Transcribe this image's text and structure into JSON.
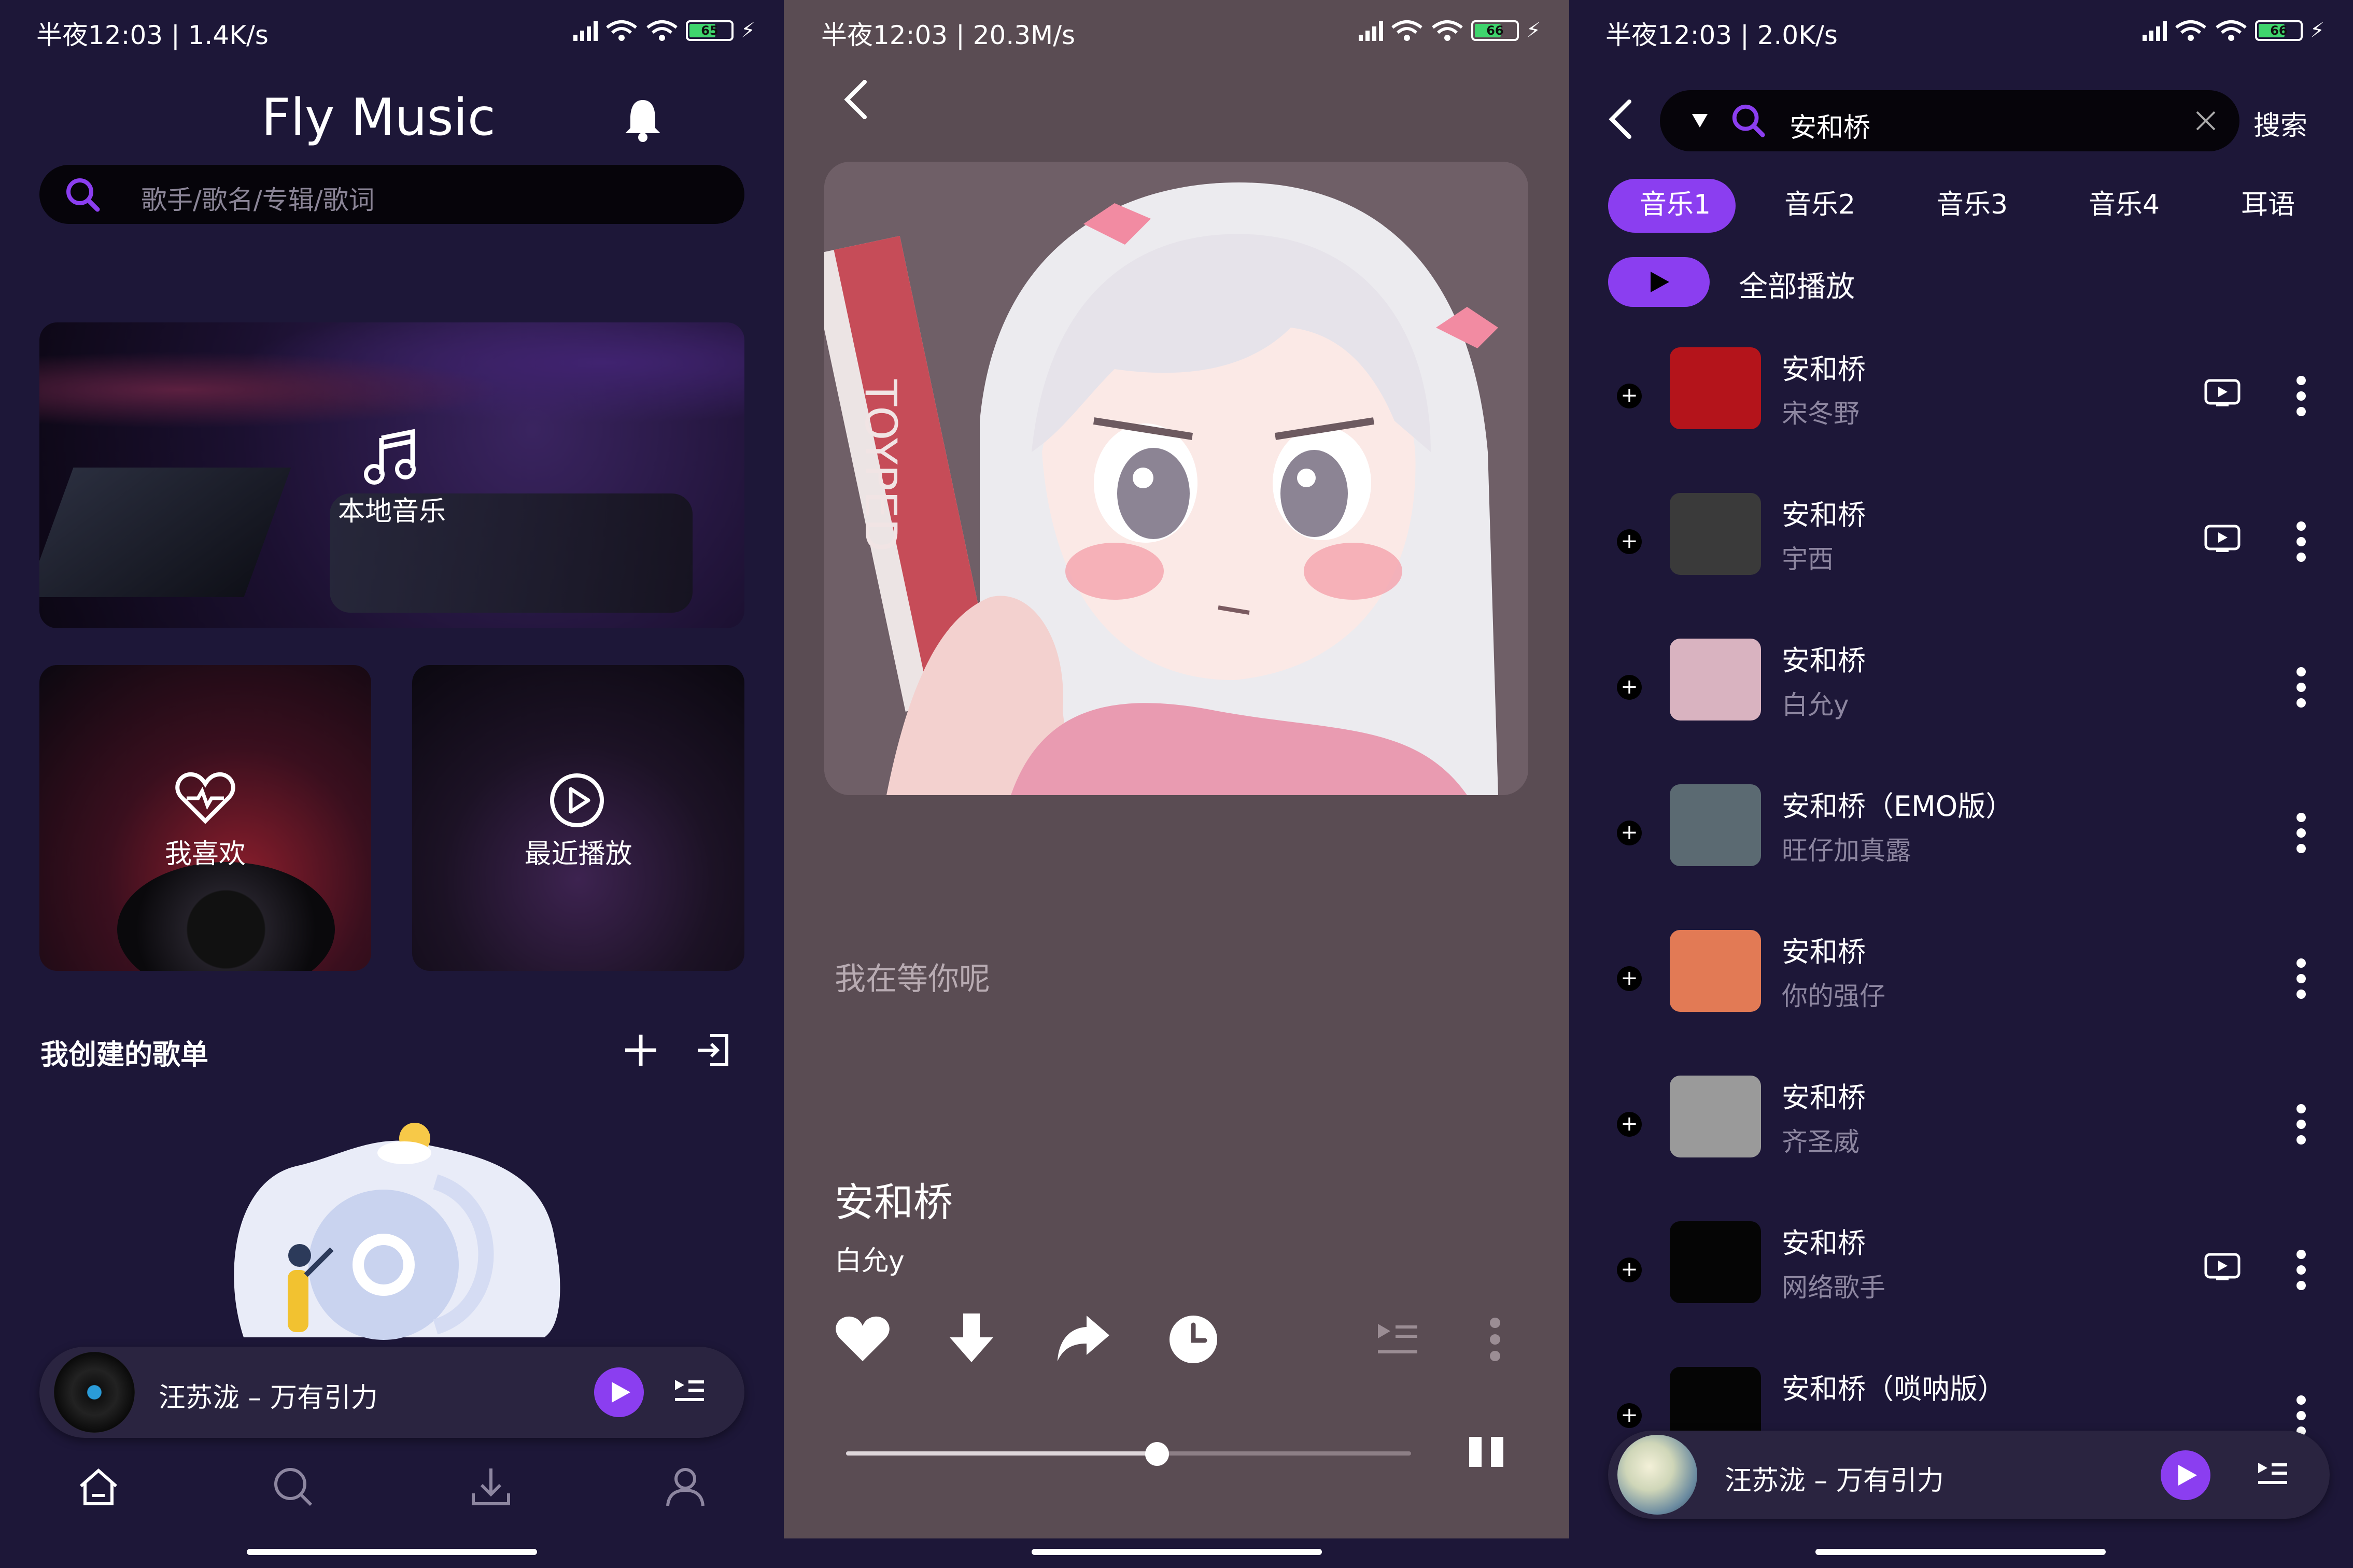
{
  "status_bars": [
    {
      "time": "半夜12:03 | 1.4K/s",
      "battery": "65"
    },
    {
      "time": "半夜12:03 | 20.3M/s",
      "battery": "66"
    },
    {
      "time": "半夜12:03 | 2.0K/s",
      "battery": "66"
    }
  ],
  "home": {
    "app_title": "Fly Music",
    "search_placeholder": "歌手/歌名/专辑/歌词",
    "local_music_label": "本地音乐",
    "favorites_label": "我喜欢",
    "recent_label": "最近播放",
    "my_playlists_title": "我创建的歌单",
    "mini_player_text": "汪苏泷 – 万有引力",
    "bottom_nav": [
      "home-icon",
      "search-icon",
      "download-icon",
      "profile-icon"
    ]
  },
  "player": {
    "lyric_line": "我在等你呢",
    "song_title": "安和桥",
    "artist": "白允y",
    "cover_text": "TOYPED",
    "progress_fraction": 0.55
  },
  "search": {
    "query": "安和桥",
    "search_button": "搜索",
    "tabs": [
      "音乐1",
      "音乐2",
      "音乐3",
      "音乐4",
      "耳语"
    ],
    "active_tab": 0,
    "play_all_label": "全部播放",
    "results": [
      {
        "title": "安和桥",
        "artist": "宋冬野",
        "has_mv": true,
        "cover_color": "#b4141b"
      },
      {
        "title": "安和桥",
        "artist": "宇西",
        "has_mv": true,
        "cover_color": "#3a3a3a"
      },
      {
        "title": "安和桥",
        "artist": "白允y",
        "has_mv": false,
        "cover_color": "#d9b3c0"
      },
      {
        "title": "安和桥（EMO版）",
        "artist": "旺仔加真露",
        "has_mv": false,
        "cover_color": "#5b6a72"
      },
      {
        "title": "安和桥",
        "artist": "你的强仔",
        "has_mv": false,
        "cover_color": "#e27a55"
      },
      {
        "title": "安和桥",
        "artist": "齐圣威",
        "has_mv": false,
        "cover_color": "#9a9a9a"
      },
      {
        "title": "安和桥",
        "artist": "网络歌手",
        "has_mv": true,
        "cover_color": "#050505"
      },
      {
        "title": "安和桥（唢呐版）",
        "artist": "",
        "has_mv": false,
        "cover_color": "#050505"
      }
    ],
    "mini_player_text": "汪苏泷 – 万有引力"
  },
  "colors": {
    "accent": "#8b3ef0",
    "background_dark": "#1d1738",
    "player_background": "#5a4c53"
  }
}
